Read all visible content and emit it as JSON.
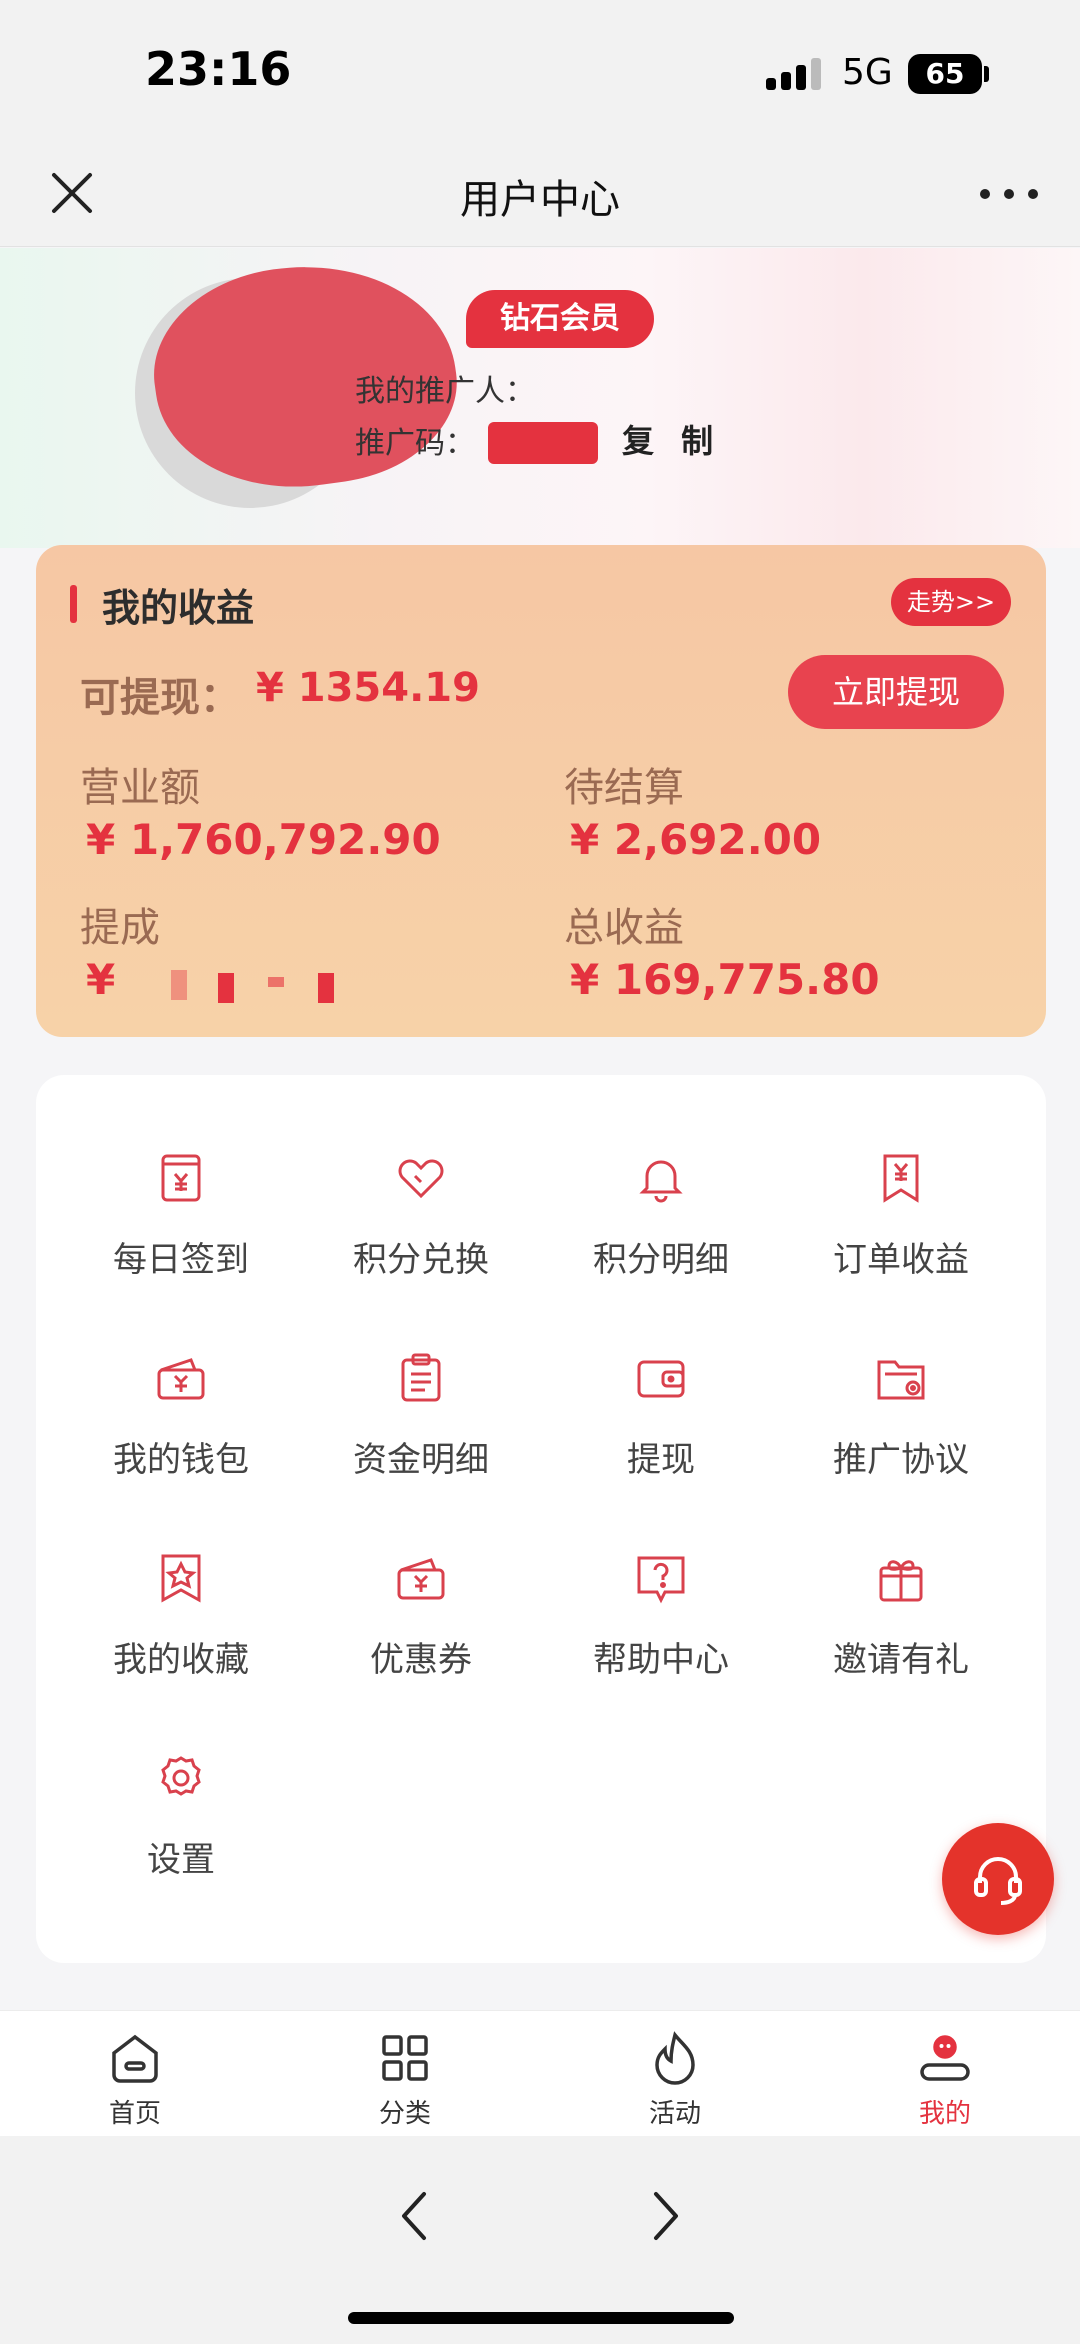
{
  "status": {
    "time": "23:16",
    "network": "5G",
    "battery": "65"
  },
  "nav": {
    "title": "用户中心"
  },
  "profile": {
    "badge": "钻石会员",
    "referrer_label": "我的推广人：",
    "code_label": "推广码：",
    "copy_label": "复 制"
  },
  "earnings": {
    "title": "我的收益",
    "trend_label": "走势>>",
    "withdrawable_label": "可提现：",
    "withdrawable_value": "¥ 1354.19",
    "withdraw_button": "立即提现",
    "revenue_label": "营业额",
    "revenue_value": "¥ 1,760,792.90",
    "pending_label": "待结算",
    "pending_value": "¥ 2,692.00",
    "commission_label": "提成",
    "commission_value": "¥",
    "total_label": "总收益",
    "total_value": "¥ 169,775.80"
  },
  "menu": {
    "items": [
      {
        "label": "每日签到",
        "icon": "daily-checkin-icon"
      },
      {
        "label": "积分兑换",
        "icon": "heart-tag-icon"
      },
      {
        "label": "积分明细",
        "icon": "bell-icon"
      },
      {
        "label": "订单收益",
        "icon": "yuan-bookmark-icon"
      },
      {
        "label": "我的钱包",
        "icon": "wallet-icon"
      },
      {
        "label": "资金明细",
        "icon": "clipboard-icon"
      },
      {
        "label": "提现",
        "icon": "wallet-card-icon"
      },
      {
        "label": "推广协议",
        "icon": "folder-icon"
      },
      {
        "label": "我的收藏",
        "icon": "star-bookmark-icon"
      },
      {
        "label": "优惠券",
        "icon": "coupon-icon"
      },
      {
        "label": "帮助中心",
        "icon": "help-icon"
      },
      {
        "label": "邀请有礼",
        "icon": "gift-icon"
      },
      {
        "label": "设置",
        "icon": "gear-icon"
      }
    ]
  },
  "tabs": [
    {
      "label": "首页",
      "icon": "home-icon"
    },
    {
      "label": "分类",
      "icon": "grid-icon"
    },
    {
      "label": "活动",
      "icon": "flame-icon"
    },
    {
      "label": "我的",
      "icon": "user-icon",
      "active": true
    }
  ],
  "colors": {
    "accent": "#e4323f",
    "card": "#f6c7a4",
    "label_brown": "#9a6a52"
  }
}
